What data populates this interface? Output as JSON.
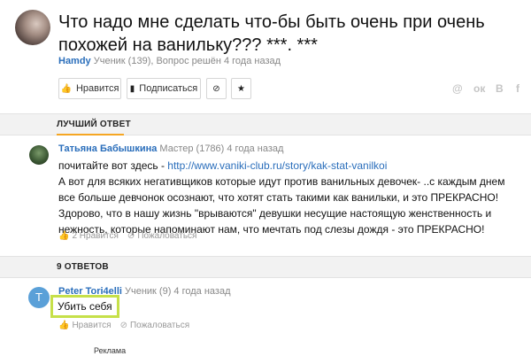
{
  "question": {
    "title": "Что надо мне сделать что-бы быть очень при очень похожей на ванильку??? ***. ***",
    "author": "Hamdy",
    "meta": "Ученик (139), Вопрос решён 4 года назад",
    "buttons": {
      "like": "Нравится",
      "subscribe": "Подписаться"
    },
    "share": [
      "@",
      "ок",
      "В",
      "f"
    ]
  },
  "best_answer": {
    "section_label": "ЛУЧШИЙ ОТВЕТ",
    "author": "Татьяна Бабышкина",
    "meta": "Мастер (1786) 4 года назад",
    "text_prefix": "почитайте вот здесь - ",
    "link": "http://www.vaniki-club.ru/story/kak-stat-vanilkoi",
    "text_body": "А вот для всяких негативщиков которые идут против ванильных девочек- ..с каждым днем все больше девчонок осознают, что хотят стать такими как ванильки, и это ПРЕКРАСНО! Здорово, что в нашу жизнь \"врываются\" девушки несущие настоящую женственность и нежность, которые напоминают нам, что мечтать под слезы дождя - это ПРЕКРАСНО!",
    "likes": "2 Нравится",
    "report": "Пожаловаться"
  },
  "answers": {
    "section_label": "9 ОТВЕТОВ",
    "items": [
      {
        "avatar_letter": "T",
        "author": "Peter Tori4elli",
        "meta": "Ученик (9) 4 года назад",
        "text": "Убить себя",
        "like": "Нравится",
        "report": "Пожаловаться"
      }
    ]
  },
  "ad_label": "Реклама"
}
